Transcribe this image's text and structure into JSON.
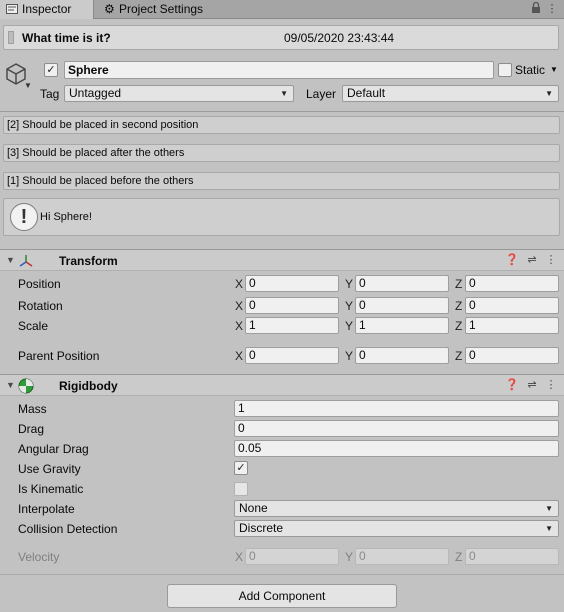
{
  "tabs": {
    "inspector_label": "Inspector",
    "project_settings_label": "Project Settings"
  },
  "time_header": {
    "label": "What time is it?",
    "value": "09/05/2020 23:43:44"
  },
  "game_object": {
    "name": "Sphere",
    "active": true,
    "static_label": "Static",
    "static_checked": false,
    "tag_label": "Tag",
    "tag_value": "Untagged",
    "layer_label": "Layer",
    "layer_value": "Default"
  },
  "messages": [
    "[2] Should be placed in second position",
    "[3] Should be placed after the others",
    "[1] Should be placed before the others"
  ],
  "help_box": {
    "icon": "exclamation-icon",
    "text": "Hi Sphere!"
  },
  "transform": {
    "title": "Transform",
    "icon": "transform-axes-icon",
    "rows": [
      {
        "label": "Position",
        "x": "0",
        "y": "0",
        "z": "0"
      },
      {
        "label": "Rotation",
        "x": "0",
        "y": "0",
        "z": "0"
      },
      {
        "label": "Scale",
        "x": "1",
        "y": "1",
        "z": "1"
      },
      {
        "label": "Parent Position",
        "x": "0",
        "y": "0",
        "z": "0"
      }
    ],
    "axis_x": "X",
    "axis_y": "Y",
    "axis_z": "Z"
  },
  "rigidbody": {
    "title": "Rigidbody",
    "icon": "rigidbody-sphere-icon",
    "mass_label": "Mass",
    "mass": "1",
    "drag_label": "Drag",
    "drag": "0",
    "angular_drag_label": "Angular Drag",
    "angular_drag": "0.05",
    "use_gravity_label": "Use Gravity",
    "use_gravity": true,
    "is_kinematic_label": "Is Kinematic",
    "is_kinematic": false,
    "interpolate_label": "Interpolate",
    "interpolate": "None",
    "collision_label": "Collision Detection",
    "collision": "Discrete",
    "velocity_label": "Velocity",
    "velocity": {
      "x": "0",
      "y": "0",
      "z": "0"
    }
  },
  "add_component_label": "Add Component",
  "colors": {
    "panel_bg": "#c2c2c2",
    "field_bg": "#f0f0f0",
    "rigidbody_icon_green": "#2f9e3a"
  }
}
